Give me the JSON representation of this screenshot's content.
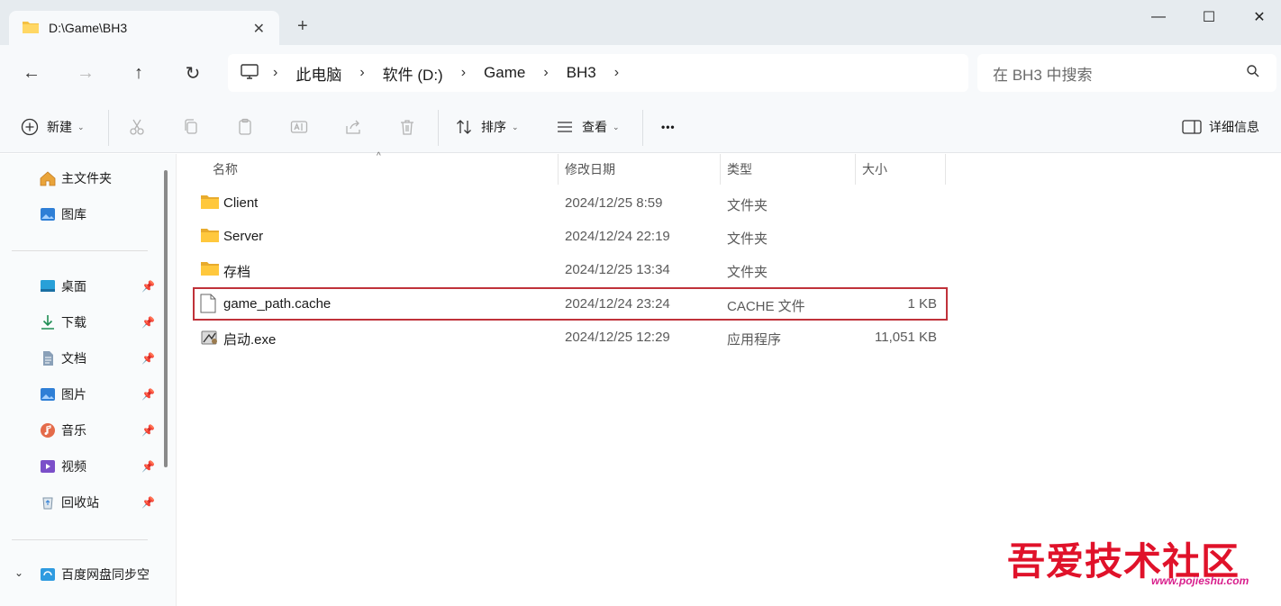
{
  "window": {
    "tab_title": "D:\\Game\\BH3",
    "controls": {
      "minimize": "—",
      "maximize": "☐",
      "close": "✕"
    }
  },
  "address": {
    "breadcrumbs": [
      "此电脑",
      "软件 (D:)",
      "Game",
      "BH3"
    ],
    "search_placeholder": "在 BH3 中搜索"
  },
  "toolbar": {
    "new_label": "新建",
    "sort_label": "排序",
    "view_label": "查看",
    "more_label": "•••",
    "details_label": "详细信息"
  },
  "sidebar": {
    "top": [
      {
        "label": "主文件夹",
        "icon": "home-icon"
      },
      {
        "label": "图库",
        "icon": "gallery-icon"
      }
    ],
    "pinned": [
      {
        "label": "桌面",
        "icon": "desktop-icon"
      },
      {
        "label": "下载",
        "icon": "download-icon"
      },
      {
        "label": "文档",
        "icon": "document-icon"
      },
      {
        "label": "图片",
        "icon": "pictures-icon"
      },
      {
        "label": "音乐",
        "icon": "music-icon"
      },
      {
        "label": "视频",
        "icon": "video-icon"
      },
      {
        "label": "回收站",
        "icon": "recycle-bin-icon"
      }
    ],
    "cloud": {
      "label": "百度网盘同步空",
      "icon": "baidu-netdisk-icon"
    }
  },
  "columns": {
    "name": "名称",
    "date": "修改日期",
    "type": "类型",
    "size": "大小"
  },
  "files": [
    {
      "name": "Client",
      "date": "2024/12/25 8:59",
      "type": "文件夹",
      "size": "",
      "icon": "folder-icon"
    },
    {
      "name": "Server",
      "date": "2024/12/24 22:19",
      "type": "文件夹",
      "size": "",
      "icon": "folder-icon"
    },
    {
      "name": "存档",
      "date": "2024/12/25 13:34",
      "type": "文件夹",
      "size": "",
      "icon": "folder-icon"
    },
    {
      "name": "game_path.cache",
      "date": "2024/12/24 23:24",
      "type": "CACHE 文件",
      "size": "1 KB",
      "icon": "file-icon",
      "highlighted": true
    },
    {
      "name": "启动.exe",
      "date": "2024/12/25 12:29",
      "type": "应用程序",
      "size": "11,051 KB",
      "icon": "exe-icon"
    }
  ],
  "watermark": {
    "title": "吾爱技术社区",
    "url": "www.pojieshu.com"
  },
  "colors": {
    "highlight_border": "#c0323a",
    "folder": "#f4c143",
    "accent": "#005fb8"
  }
}
